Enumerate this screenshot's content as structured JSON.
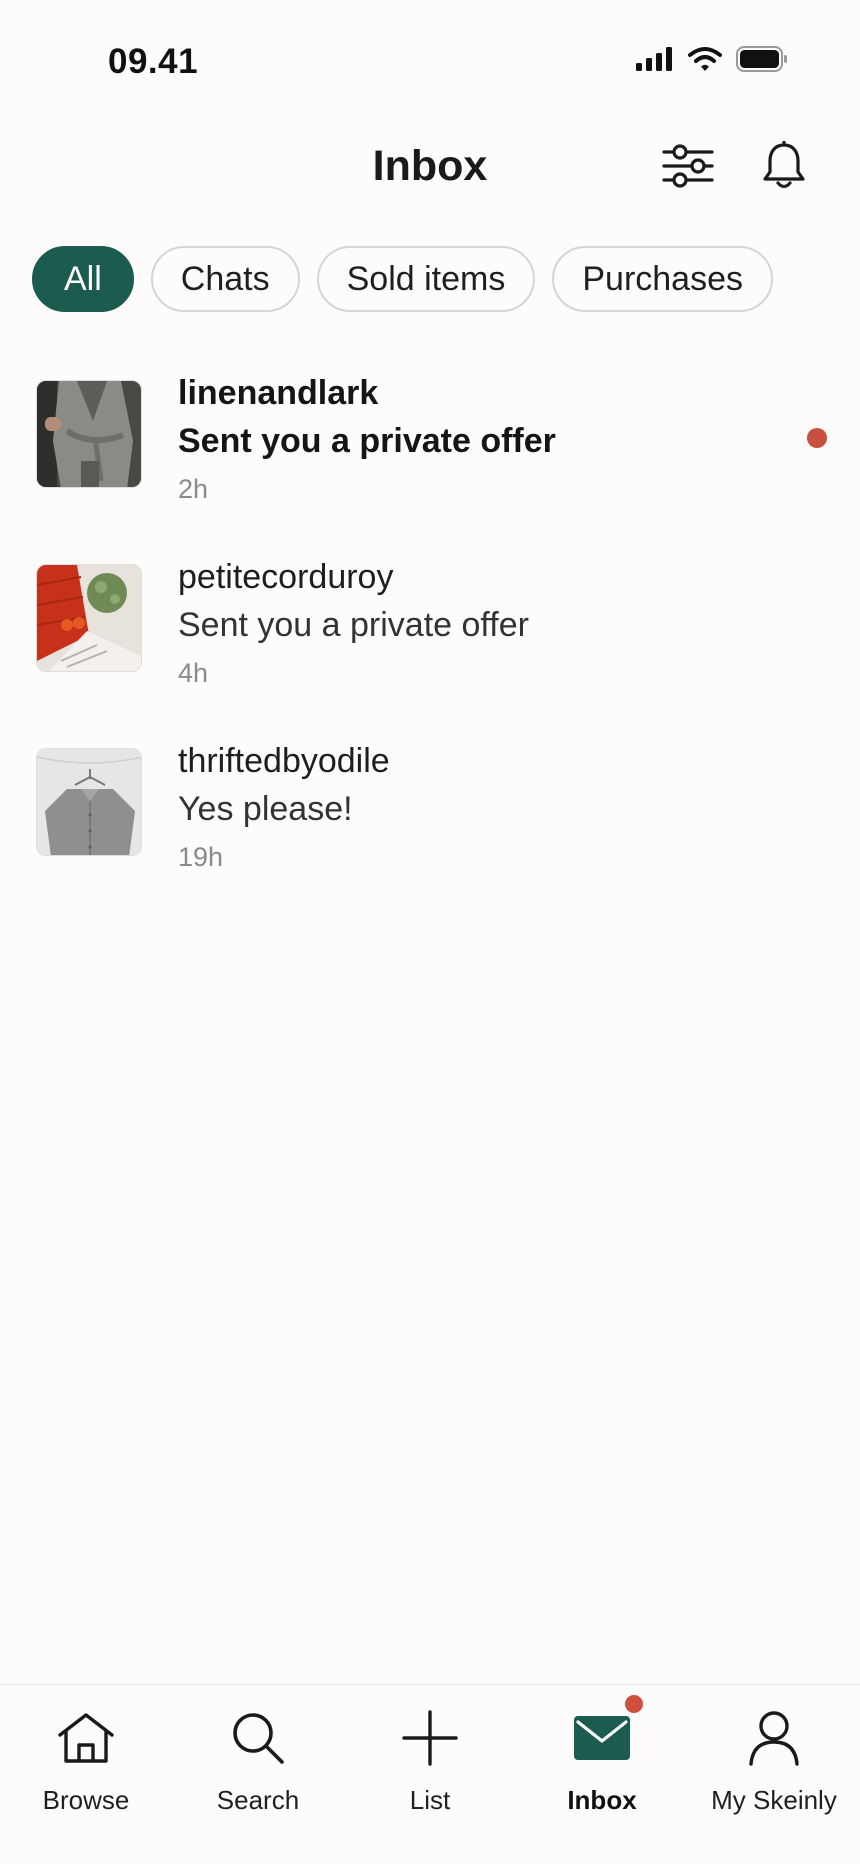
{
  "status_bar": {
    "time": "09.41",
    "icons": [
      "signal-icon",
      "wifi-icon",
      "battery-icon"
    ]
  },
  "header": {
    "title": "Inbox",
    "icons": [
      "filter-icon",
      "bell-icon"
    ]
  },
  "filters": {
    "chips": [
      {
        "label": "All",
        "active": true
      },
      {
        "label": "Chats",
        "active": false
      },
      {
        "label": "Sold items",
        "active": false
      },
      {
        "label": "Purchases",
        "active": false
      }
    ]
  },
  "conversations": [
    {
      "username": "linenandlark",
      "message": "Sent you a private offer",
      "time": "2h",
      "unread": true
    },
    {
      "username": "petitecorduroy",
      "message": "Sent you a private offer",
      "time": "4h",
      "unread": false
    },
    {
      "username": "thriftedbyodile",
      "message": "Yes please!",
      "time": "19h",
      "unread": false
    }
  ],
  "bottom_nav": {
    "items": [
      {
        "label": "Browse",
        "icon": "home-icon",
        "active": false
      },
      {
        "label": "Search",
        "icon": "search-icon",
        "active": false
      },
      {
        "label": "List",
        "icon": "plus-icon",
        "active": false
      },
      {
        "label": "Inbox",
        "icon": "mail-icon",
        "active": true,
        "badge": true
      },
      {
        "label": "My Skeinly",
        "icon": "profile-icon",
        "active": false
      }
    ]
  },
  "colors": {
    "accent": "#1c5c4f",
    "unread_dot": "#c9503f",
    "background": "#fdfcfa"
  }
}
